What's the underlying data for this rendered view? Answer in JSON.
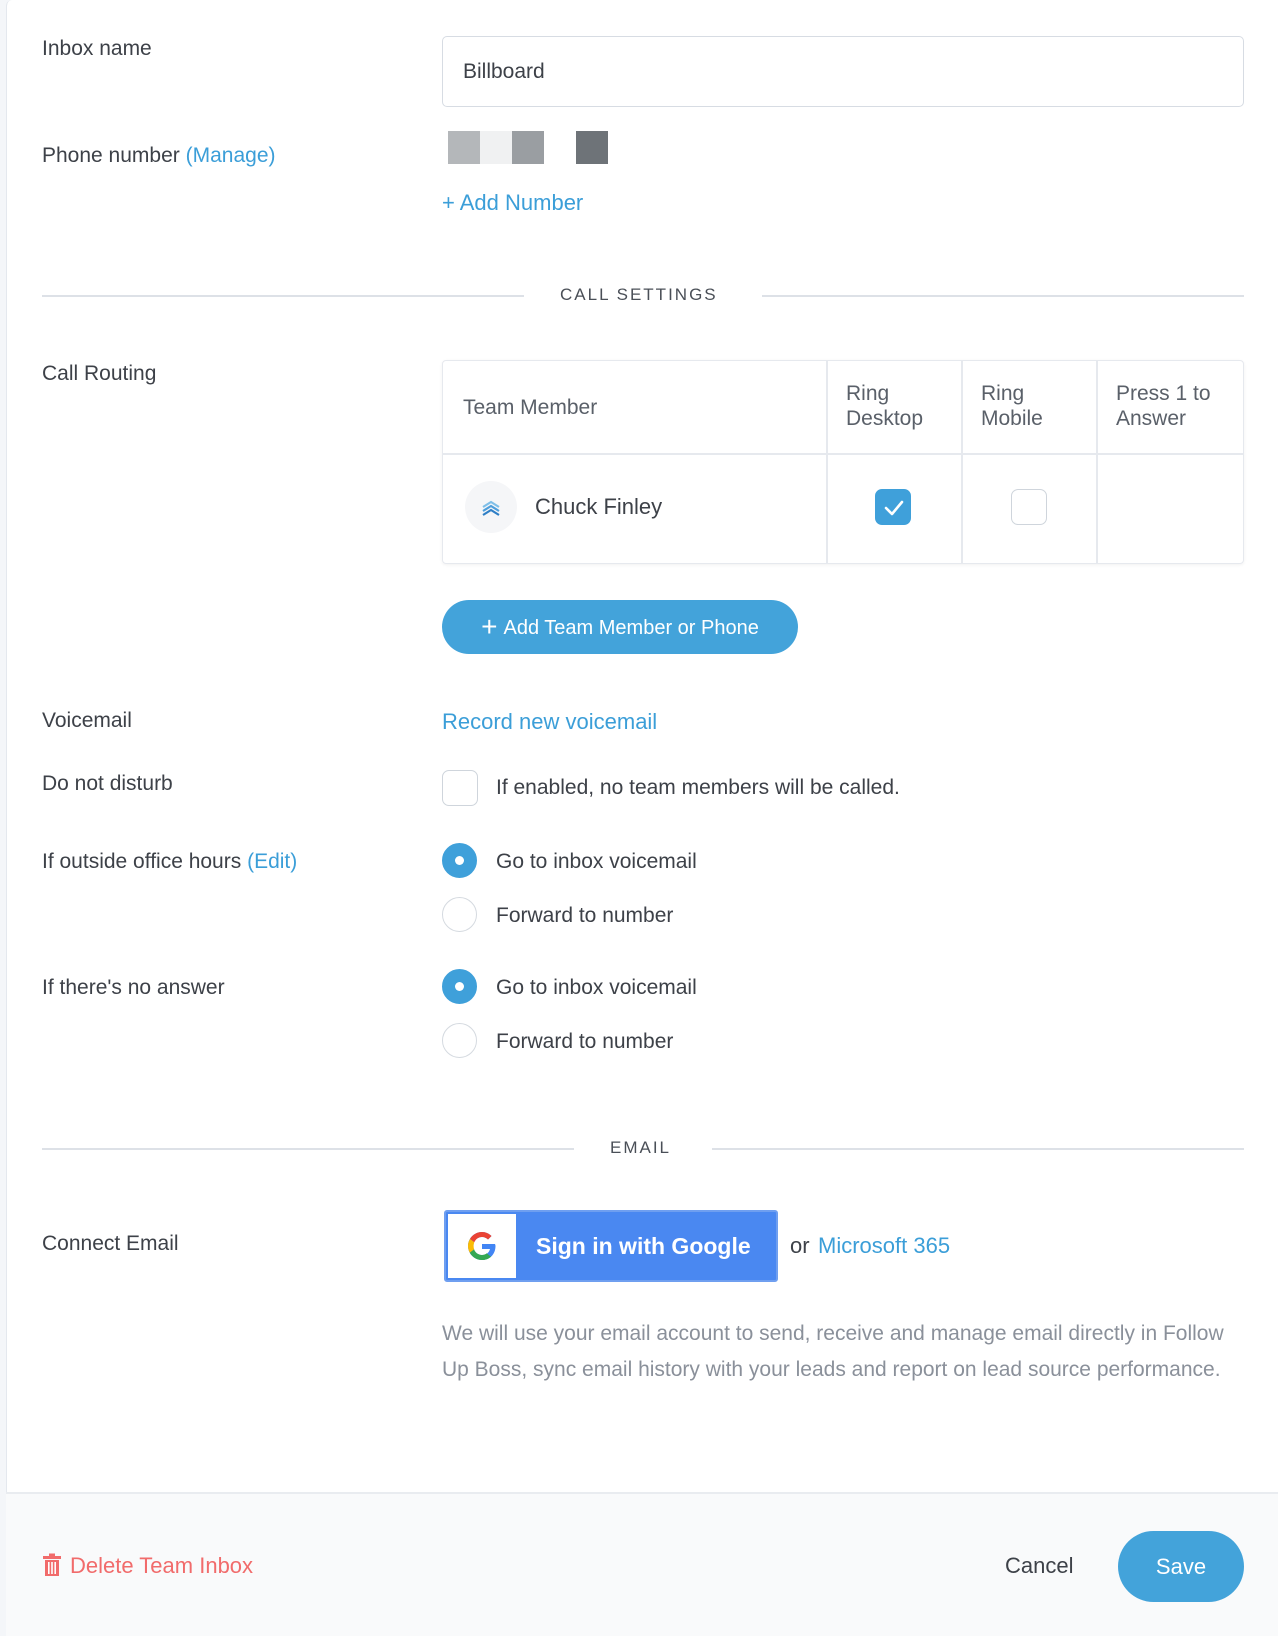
{
  "form": {
    "inbox_name_label": "Inbox name",
    "inbox_name_value": "Billboard",
    "phone_number_label": "Phone number",
    "phone_manage_link": "(Manage)",
    "add_number_link": "+ Add Number"
  },
  "call_settings": {
    "section_title": "CALL SETTINGS",
    "call_routing_label": "Call Routing",
    "table": {
      "headers": [
        "Team Member",
        "Ring Desktop",
        "Ring Mobile",
        "Press 1 to Answer"
      ],
      "header_lines": [
        [
          "Team Member"
        ],
        [
          "Ring",
          "Desktop"
        ],
        [
          "Ring",
          "Mobile"
        ],
        [
          "Press 1 to",
          "Answer"
        ]
      ],
      "rows": [
        {
          "name": "Chuck Finley",
          "avatar_icon": "chevrons-logo-icon",
          "ring_desktop": true,
          "ring_mobile": false,
          "press_1_to_answer": ""
        }
      ]
    },
    "add_member_button": "Add Team Member or Phone",
    "voicemail_label": "Voicemail",
    "record_voicemail_link": "Record new voicemail",
    "dnd_label": "Do not disturb",
    "dnd_checked": false,
    "dnd_description": "If enabled, no team members will be called.",
    "outside_hours_label": "If outside office hours",
    "outside_hours_edit_link": "(Edit)",
    "outside_hours_options": [
      {
        "label": "Go to inbox voicemail",
        "selected": true
      },
      {
        "label": "Forward to number",
        "selected": false
      }
    ],
    "no_answer_label": "If there's no answer",
    "no_answer_options": [
      {
        "label": "Go to inbox voicemail",
        "selected": true
      },
      {
        "label": "Forward to number",
        "selected": false
      }
    ]
  },
  "email": {
    "section_title": "EMAIL",
    "connect_label": "Connect Email",
    "google_button": "Sign in with Google",
    "or_text": "or",
    "microsoft_link": "Microsoft 365",
    "description": "We will use your email account to send, receive and manage email directly in Follow Up Boss, sync email history with your leads and report on lead source performance."
  },
  "footer": {
    "delete_label": "Delete Team Inbox",
    "cancel_label": "Cancel",
    "save_label": "Save"
  },
  "colors": {
    "accent": "#43a3da",
    "danger": "#f16b6b",
    "google_blue": "#4a88f1"
  }
}
